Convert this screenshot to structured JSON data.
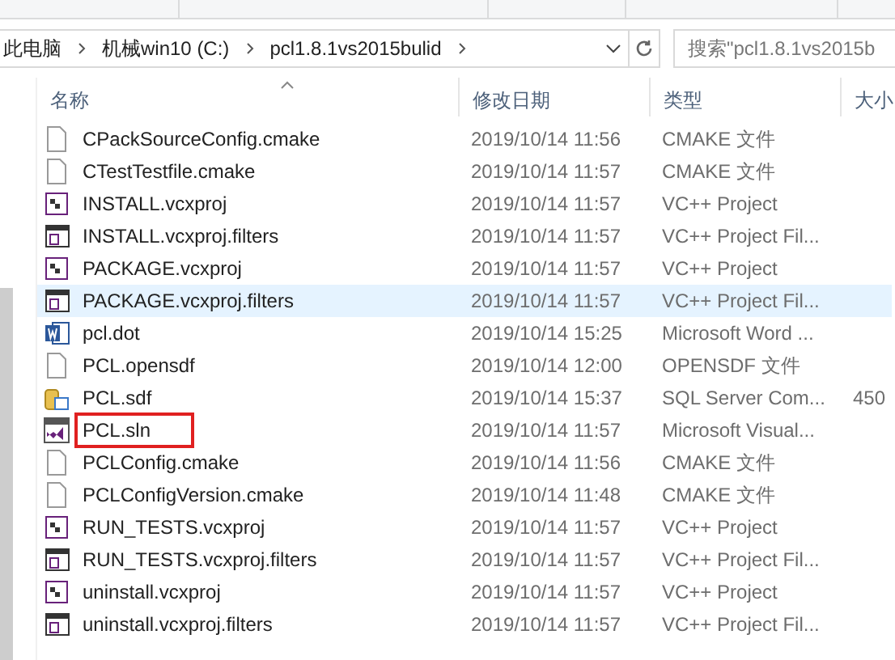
{
  "breadcrumb": [
    "此电脑",
    "机械win10 (C:)",
    "pcl1.8.1vs2015bulid"
  ],
  "search": {
    "placeholder": "搜索\"pcl1.8.1vs2015b"
  },
  "columns": [
    "名称",
    "修改日期",
    "类型",
    "大小"
  ],
  "files": [
    {
      "name": "CPackSourceConfig.cmake",
      "date": "2019/10/14 11:56",
      "type": "CMAKE 文件",
      "kind": "doc",
      "selected": false,
      "highlighted": false
    },
    {
      "name": "CTestTestfile.cmake",
      "date": "2019/10/14 11:57",
      "type": "CMAKE 文件",
      "kind": "doc",
      "selected": false,
      "highlighted": false
    },
    {
      "name": "INSTALL.vcxproj",
      "date": "2019/10/14 11:57",
      "type": "VC++ Project",
      "kind": "vcxproj",
      "selected": false,
      "highlighted": false
    },
    {
      "name": "INSTALL.vcxproj.filters",
      "date": "2019/10/14 11:57",
      "type": "VC++ Project Fil...",
      "kind": "filters",
      "selected": false,
      "highlighted": false
    },
    {
      "name": "PACKAGE.vcxproj",
      "date": "2019/10/14 11:57",
      "type": "VC++ Project",
      "kind": "vcxproj",
      "selected": false,
      "highlighted": false
    },
    {
      "name": "PACKAGE.vcxproj.filters",
      "date": "2019/10/14 11:57",
      "type": "VC++ Project Fil...",
      "kind": "filters",
      "selected": true,
      "highlighted": false
    },
    {
      "name": "pcl.dot",
      "date": "2019/10/14 15:25",
      "type": "Microsoft Word ...",
      "kind": "word",
      "selected": false,
      "highlighted": false
    },
    {
      "name": "PCL.opensdf",
      "date": "2019/10/14 12:00",
      "type": "OPENSDF 文件",
      "kind": "doc",
      "selected": false,
      "highlighted": false
    },
    {
      "name": "PCL.sdf",
      "date": "2019/10/14 15:37",
      "type": "SQL Server Com...",
      "size": "450",
      "kind": "sdf",
      "selected": false,
      "highlighted": false
    },
    {
      "name": "PCL.sln",
      "date": "2019/10/14 11:57",
      "type": "Microsoft Visual...",
      "kind": "sln",
      "selected": false,
      "highlighted": true
    },
    {
      "name": "PCLConfig.cmake",
      "date": "2019/10/14 11:56",
      "type": "CMAKE 文件",
      "kind": "doc",
      "selected": false,
      "highlighted": false
    },
    {
      "name": "PCLConfigVersion.cmake",
      "date": "2019/10/14 11:48",
      "type": "CMAKE 文件",
      "kind": "doc",
      "selected": false,
      "highlighted": false
    },
    {
      "name": "RUN_TESTS.vcxproj",
      "date": "2019/10/14 11:57",
      "type": "VC++ Project",
      "kind": "vcxproj",
      "selected": false,
      "highlighted": false
    },
    {
      "name": "RUN_TESTS.vcxproj.filters",
      "date": "2019/10/14 11:57",
      "type": "VC++ Project Fil...",
      "kind": "filters",
      "selected": false,
      "highlighted": false
    },
    {
      "name": "uninstall.vcxproj",
      "date": "2019/10/14 11:57",
      "type": "VC++ Project",
      "kind": "vcxproj",
      "selected": false,
      "highlighted": false
    },
    {
      "name": "uninstall.vcxproj.filters",
      "date": "2019/10/14 11:57",
      "type": "VC++ Project Fil...",
      "kind": "filters",
      "selected": false,
      "highlighted": false
    }
  ]
}
